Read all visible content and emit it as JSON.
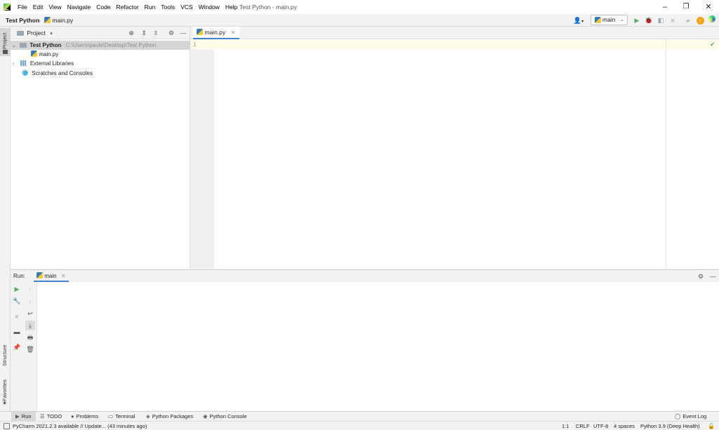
{
  "menubar": {
    "items": [
      "File",
      "Edit",
      "View",
      "Navigate",
      "Code",
      "Refactor",
      "Run",
      "Tools",
      "VCS",
      "Window",
      "Help"
    ],
    "window_title": "Test Python - main.py",
    "controls": {
      "minimize": "–",
      "restore": "❐",
      "close": "✕"
    }
  },
  "navbar": {
    "breadcrumb_project": "Test Python",
    "breadcrumb_sep": "›",
    "breadcrumb_file": "main.py",
    "run_config": "main",
    "icons": [
      "user-icon",
      "run-icon",
      "debug-icon",
      "coverage-icon",
      "stop-icon",
      "search-icon",
      "update-icon",
      "plugin-icon"
    ]
  },
  "left_stripe": {
    "project_tab": "Project",
    "structure_tab": "Structure",
    "favorites_tab": "Favorites"
  },
  "project_panel": {
    "title": "Project",
    "tree": {
      "root_name": "Test Python",
      "root_path": "C:\\Users\\paule\\Desktop\\Test Python",
      "file": "main.py",
      "libraries": "External Libraries",
      "scratches": "Scratches and Consoles"
    }
  },
  "editor": {
    "tab_label": "main.py",
    "line_number": "1"
  },
  "run_panel": {
    "label": "Run:",
    "tab": "main"
  },
  "bottom_bar": {
    "run": "Run",
    "todo": "TODO",
    "problems": "Problems",
    "terminal": "Terminal",
    "python_packages": "Python Packages",
    "python_console": "Python Console",
    "event_log": "Event Log"
  },
  "status_bar": {
    "message": "PyCharm 2021.2.3 available // Update... (43 minutes ago)",
    "position": "1:1",
    "line_sep": "CRLF",
    "encoding": "UTF-8",
    "indent": "4 spaces",
    "interpreter": "Python 3.9 (Deep Health)"
  },
  "colors": {
    "accent": "#4083c9",
    "run_green": "#59a869",
    "selection": "#d5d5d5",
    "current_line": "#fefce6"
  }
}
